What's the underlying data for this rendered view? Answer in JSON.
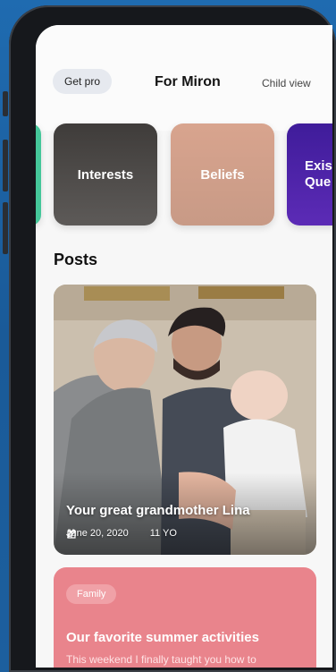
{
  "header": {
    "get_pro_label": "Get pro",
    "title": "For Miron",
    "child_view_label": "Child view"
  },
  "categories": [
    {
      "label": ""
    },
    {
      "label": "Interests"
    },
    {
      "label": "Beliefs"
    },
    {
      "label": "Exist\nQue"
    }
  ],
  "sections": {
    "posts_heading": "Posts"
  },
  "posts": [
    {
      "title": "Your great grandmother Lina",
      "date": "June 20, 2020",
      "age": "11 YO"
    },
    {
      "tag": "Family",
      "title": "Our favorite summer activities",
      "excerpt": "This weekend I finally taught you how to"
    }
  ],
  "colors": {
    "green": "#45c79a",
    "interests": "#4a4745",
    "beliefs": "#d4a08c",
    "existential": "#4a22a8",
    "family_card": "#e9848c"
  },
  "icons": {
    "pencil": "pencil-icon",
    "gift": "gift-icon"
  }
}
